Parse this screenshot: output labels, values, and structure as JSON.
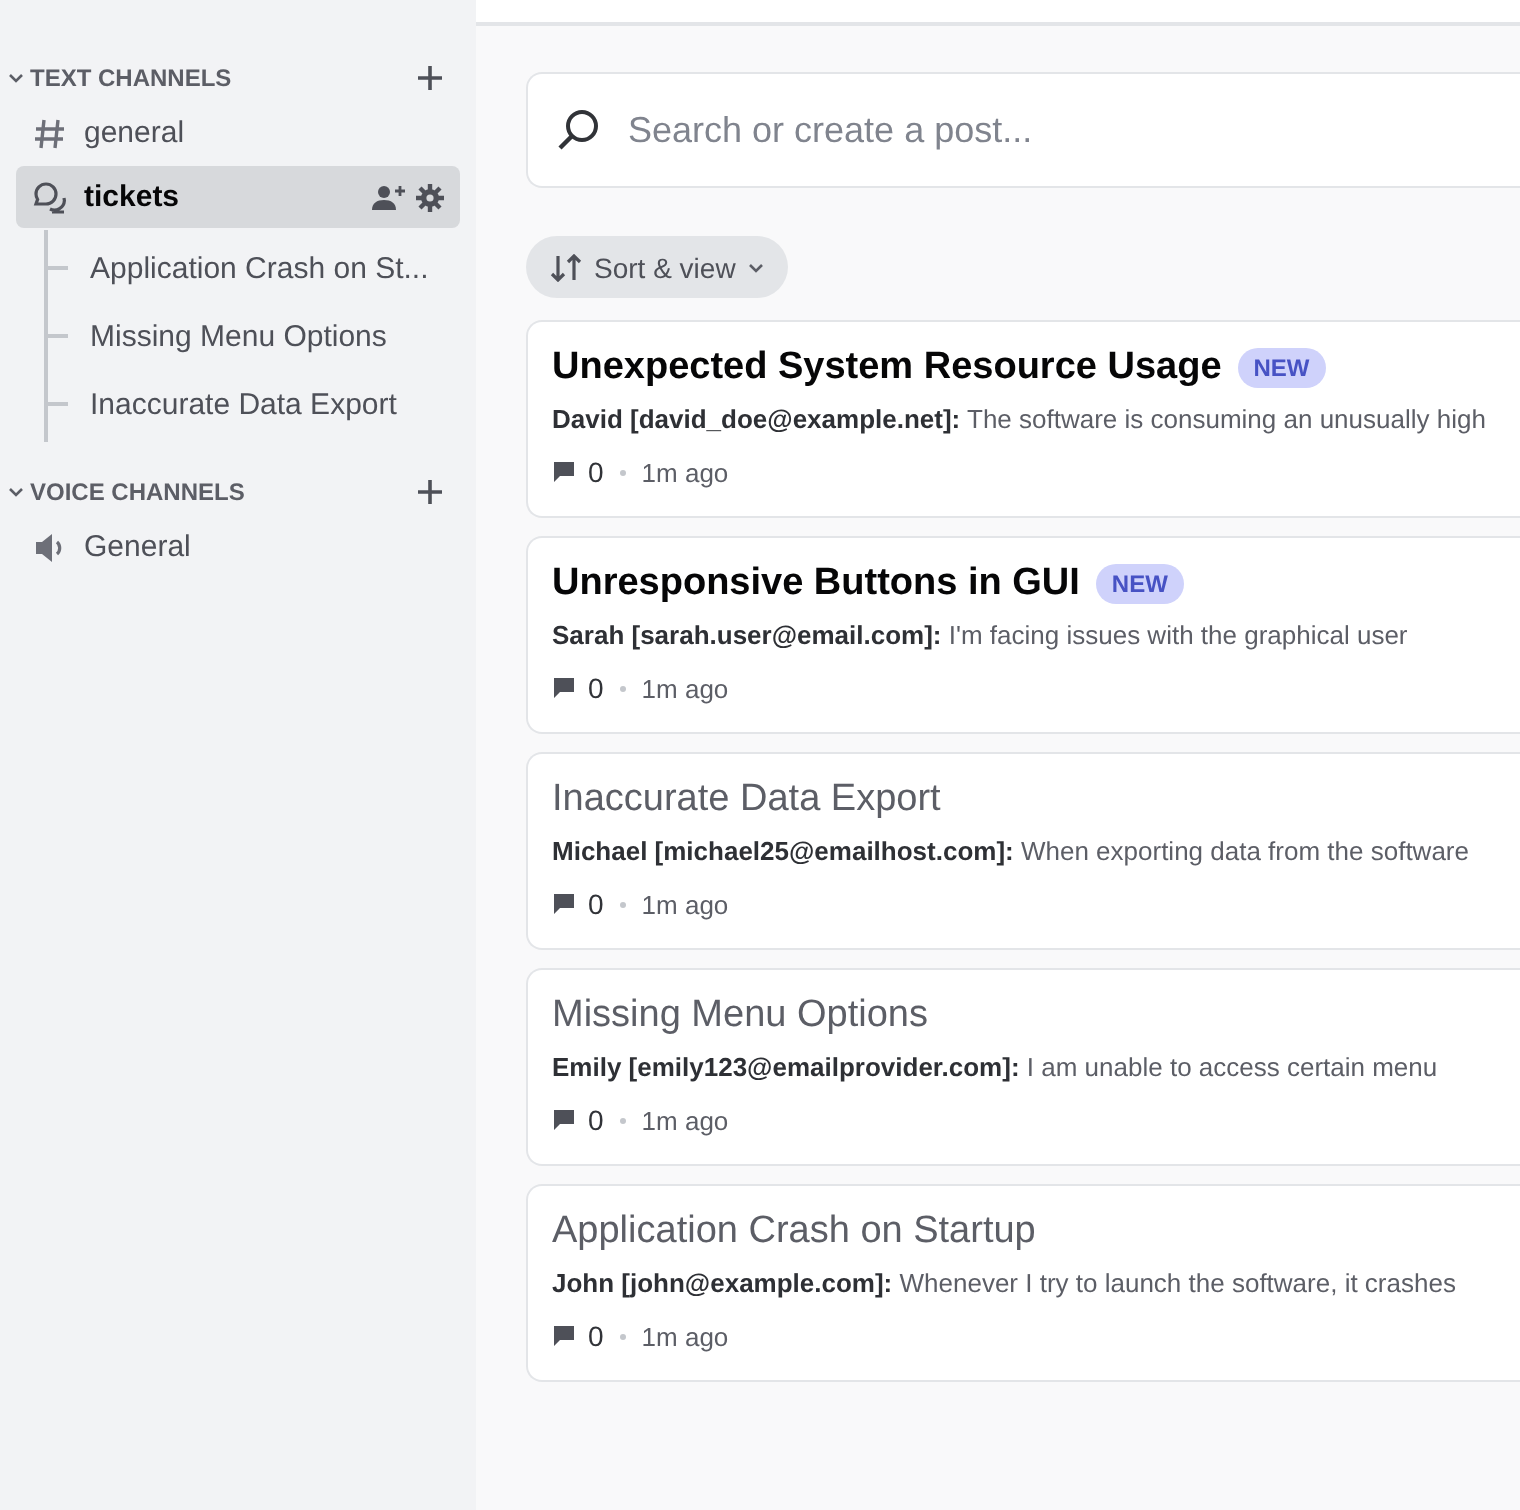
{
  "sidebar": {
    "categories": [
      {
        "label": "TEXT CHANNELS",
        "expanded": true,
        "channels": [
          {
            "kind": "text",
            "name": "general",
            "selected": false
          },
          {
            "kind": "forum",
            "name": "tickets",
            "selected": true,
            "children": [
              {
                "name": "Application Crash on St..."
              },
              {
                "name": "Missing Menu Options"
              },
              {
                "name": "Inaccurate Data Export"
              }
            ]
          }
        ]
      },
      {
        "label": "VOICE CHANNELS",
        "expanded": true,
        "channels": [
          {
            "kind": "voice",
            "name": "General",
            "selected": false
          }
        ]
      }
    ]
  },
  "search": {
    "placeholder": "Search or create a post..."
  },
  "sort_button": {
    "label": "Sort & view"
  },
  "posts": [
    {
      "title": "Unexpected System Resource Usage",
      "badge": "NEW",
      "unread": true,
      "author": "David [david_doe@example.net]:",
      "preview": "The software is consuming an unusually high",
      "replies": "0",
      "time": "1m ago"
    },
    {
      "title": "Unresponsive Buttons in GUI",
      "badge": "NEW",
      "unread": true,
      "author": "Sarah [sarah.user@email.com]:",
      "preview": "I'm facing issues with the graphical user",
      "replies": "0",
      "time": "1m ago"
    },
    {
      "title": "Inaccurate Data Export",
      "unread": false,
      "author": "Michael [michael25@emailhost.com]:",
      "preview": "When exporting data from the software",
      "replies": "0",
      "time": "1m ago"
    },
    {
      "title": "Missing Menu Options",
      "unread": false,
      "author": "Emily [emily123@emailprovider.com]:",
      "preview": "I am unable to access certain menu",
      "replies": "0",
      "time": "1m ago"
    },
    {
      "title": "Application Crash on Startup",
      "unread": false,
      "author": "John [john@example.com]:",
      "preview": "Whenever I try to launch the software, it crashes",
      "replies": "0",
      "time": "1m ago"
    }
  ]
}
